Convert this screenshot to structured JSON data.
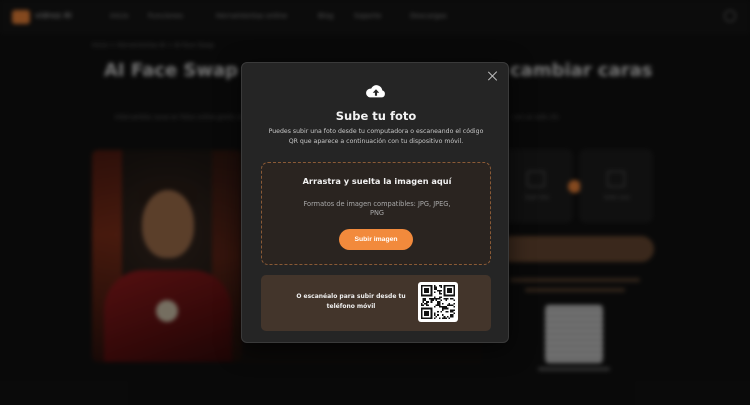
{
  "background": {
    "nav": {
      "logo_text": "vidnoz AI",
      "items": [
        "Inicio",
        "Funciones",
        "Herramientas online",
        "Blog",
        "Soporte",
        "Descargas"
      ]
    },
    "breadcrumb": "Inicio > Herramientas AI > AI Face Swap",
    "hero": {
      "title_left": "AI Face Swap",
      "title_right": "cambiar caras",
      "subtitle_left": "Intercambia caras en fotos online gratis con IA",
      "subtitle_right": "con un solo clic"
    },
    "cards": [
      {
        "label": "Subir foto"
      },
      {
        "label": "Subir cara"
      }
    ]
  },
  "modal": {
    "title": "Sube tu foto",
    "description": "Puedes subir una foto desde tu computadora o escaneando el código QR que aparece a continuación con tu dispositivo móvil.",
    "dropzone": {
      "title": "Arrastra y suelta la imagen aquí",
      "formats": "Formatos de imagen compatibles: JPG, JPEG, PNG",
      "button_label": "Subir imagen"
    },
    "qr": {
      "text": "O escanéalo para subir desde tu teléfono móvil"
    },
    "icons": {
      "close": "close-icon",
      "upload": "cloud-upload-icon"
    }
  },
  "colors": {
    "accent": "#f28a3c",
    "modal_bg": "#252525",
    "dropzone_border": "#8a5a36",
    "qr_box_bg": "#43352b"
  }
}
